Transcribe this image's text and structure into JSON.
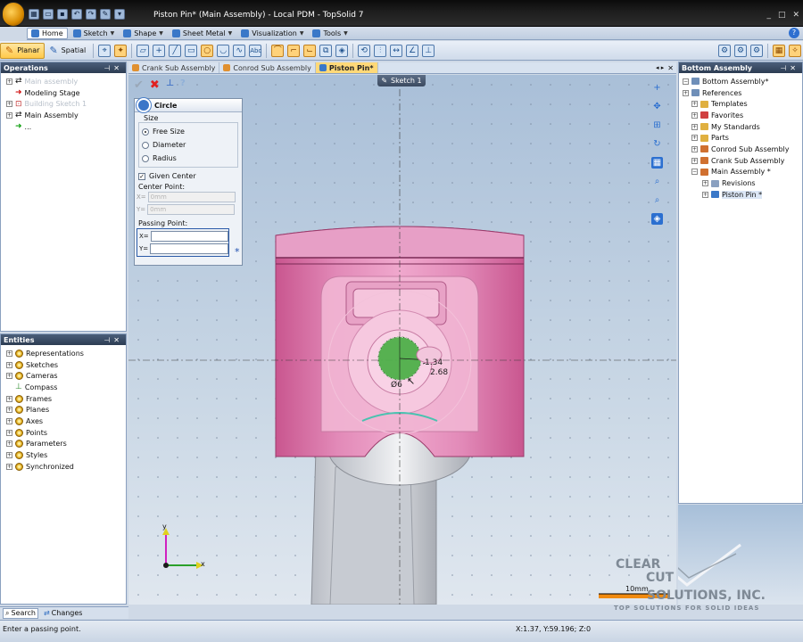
{
  "window": {
    "title": "Piston Pin* (Main Assembly) - Local PDM - TopSolid 7",
    "controls": [
      "_",
      "□",
      "✕"
    ]
  },
  "ribbon_tabs": [
    {
      "label": "Home"
    },
    {
      "label": "Sketch"
    },
    {
      "label": "Shape"
    },
    {
      "label": "Sheet Metal"
    },
    {
      "label": "Visualization"
    },
    {
      "label": "Tools"
    }
  ],
  "toolbar": {
    "planar": "Planar",
    "spatial": "Spatial"
  },
  "operations": {
    "title": "Operations",
    "items": [
      {
        "label": "Main assembly",
        "dim": true
      },
      {
        "label": "Modeling Stage",
        "dim": false
      },
      {
        "label": "Building Sketch 1",
        "dim": true
      },
      {
        "label": "Main Assembly",
        "dim": false
      },
      {
        "label": "...",
        "dim": false
      }
    ]
  },
  "entities": {
    "title": "Entities",
    "items": [
      "Representations",
      "Sketches",
      "Cameras",
      "Compass",
      "Frames",
      "Planes",
      "Axes",
      "Points",
      "Parameters",
      "Styles",
      "Synchronized"
    ]
  },
  "doc_tabs": [
    "Crank Sub Assembly",
    "Conrod Sub Assembly",
    "Piston Pin*"
  ],
  "sketch_label": "Sketch 1",
  "dialog": {
    "title": "Circle",
    "size_label": "Size",
    "options": [
      "Free Size",
      "Diameter",
      "Radius"
    ],
    "given_center": "Given Center",
    "center_point": "Center Point:",
    "cx": "0mm",
    "cy": "0mm",
    "passing_point": "Passing Point:",
    "x_lbl": "X=",
    "y_lbl": "Y="
  },
  "dims": {
    "d1": "1.34",
    "d2": "2.68",
    "diam": "Ø6"
  },
  "axes": {
    "x": "x",
    "y": "y"
  },
  "scale": "10mm",
  "bottom_assembly": {
    "title": "Bottom Assembly",
    "items": [
      {
        "label": "Bottom Assembly*",
        "indent": 0
      },
      {
        "label": "References",
        "indent": 0
      },
      {
        "label": "Templates",
        "indent": 1
      },
      {
        "label": "Favorites",
        "indent": 1
      },
      {
        "label": "My Standards",
        "indent": 1
      },
      {
        "label": "Parts",
        "indent": 1
      },
      {
        "label": "Conrod Sub Assembly",
        "indent": 1
      },
      {
        "label": "Crank Sub Assembly",
        "indent": 1
      },
      {
        "label": "Main Assembly *",
        "indent": 1
      },
      {
        "label": "Revisions",
        "indent": 2
      },
      {
        "label": "Piston Pin *",
        "indent": 2
      }
    ]
  },
  "watermark": {
    "line1": "CLEAR",
    "line2": "CUT",
    "line3": "SOLUTIONS, INC.",
    "tag": "TOP SOLUTIONS FOR SOLID IDEAS"
  },
  "bottom_tabs": [
    "Search",
    "Changes"
  ],
  "status": {
    "message": "Enter a passing point.",
    "coords": "X:1.37, Y:59.196; Z:0"
  }
}
